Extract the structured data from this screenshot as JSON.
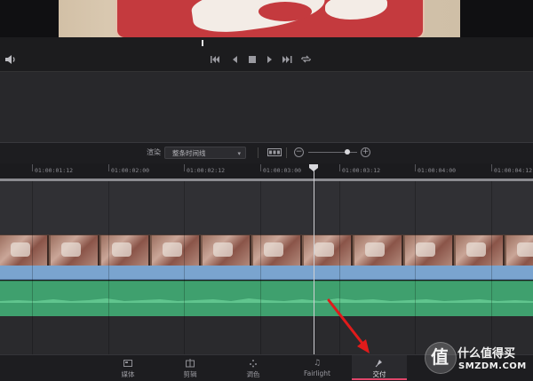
{
  "render": {
    "label": "渲染",
    "selected": "整条时间线"
  },
  "ruler": {
    "timecodes": [
      "01:00:01:12",
      "01:00:02:00",
      "01:00:02:12",
      "01:00:03:00",
      "01:00:03:12",
      "01:00:04:00",
      "01:00:04:12"
    ]
  },
  "pages": [
    {
      "label": "媒体",
      "icon": "media-icon"
    },
    {
      "label": "剪辑",
      "icon": "edit-icon"
    },
    {
      "label": "调色",
      "icon": "color-icon"
    },
    {
      "label": "Fairlight",
      "icon": "music-note-icon"
    },
    {
      "label": "交付",
      "icon": "rocket-icon"
    }
  ],
  "active_page": "交付",
  "watermark": {
    "char": "值",
    "title": "什么值得买",
    "subtitle": "SMZDM.COM"
  },
  "colors": {
    "accent": "#e0456a",
    "audio": "#3fa06e",
    "blue_track": "#7aa4cf",
    "arrow": "#e01b1b"
  }
}
